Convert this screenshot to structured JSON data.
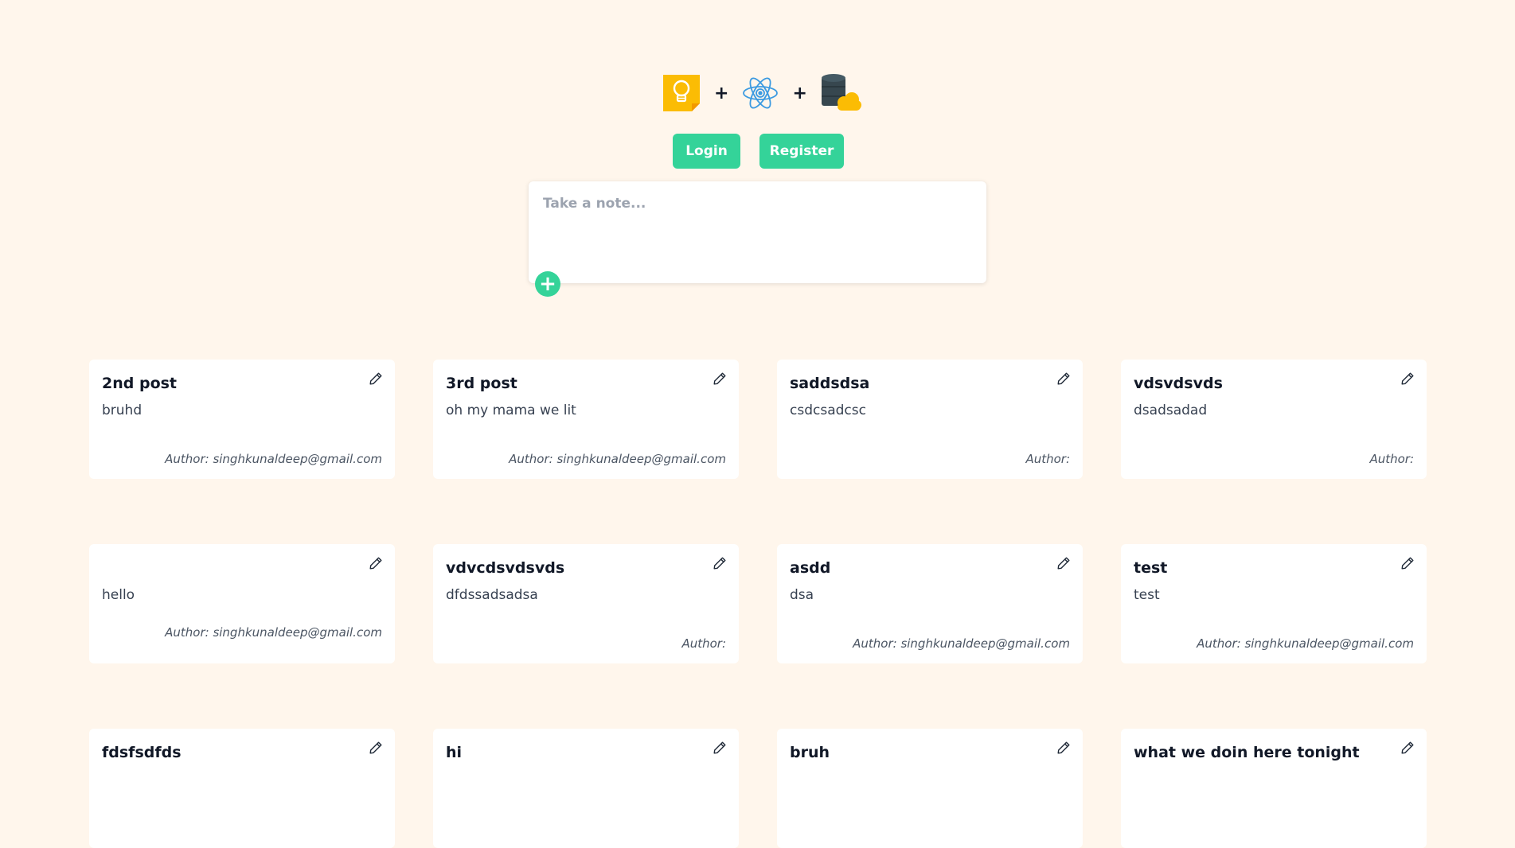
{
  "header": {
    "logos": [
      {
        "icon": "lightbulb-note-icon",
        "color": "#fbbc04"
      },
      {
        "icon": "react-atom-icon",
        "color": "#3b9ae1"
      },
      {
        "icon": "database-cloud-icon",
        "color": "#37474f"
      }
    ],
    "plus_1": "+",
    "plus_2": "+"
  },
  "auth": {
    "login_label": "Login",
    "register_label": "Register"
  },
  "composer": {
    "placeholder": "Take a note...",
    "add_label": "+"
  },
  "colors": {
    "background": "#fff6ec",
    "accent": "#34d399",
    "card": "#ffffff"
  },
  "notes": [
    {
      "title": "2nd post",
      "body": "bruhd",
      "author": "Author: singhkunaldeep@gmail.com"
    },
    {
      "title": "3rd post",
      "body": "oh my mama we lit",
      "author": "Author: singhkunaldeep@gmail.com"
    },
    {
      "title": "saddsdsa",
      "body": "csdcsadcsc",
      "author": "Author:"
    },
    {
      "title": "vdsvdsvds",
      "body": "dsadsadad",
      "author": "Author:"
    },
    {
      "title": "",
      "body": "hello",
      "author": "Author: singhkunaldeep@gmail.com"
    },
    {
      "title": "vdvcdsvdsvds",
      "body": "dfdssadsadsa",
      "author": "Author:"
    },
    {
      "title": "asdd",
      "body": "dsa",
      "author": "Author: singhkunaldeep@gmail.com"
    },
    {
      "title": "test",
      "body": "test",
      "author": "Author: singhkunaldeep@gmail.com"
    },
    {
      "title": "fdsfsdfds",
      "body": "",
      "author": ""
    },
    {
      "title": "hi",
      "body": "",
      "author": ""
    },
    {
      "title": "bruh",
      "body": "",
      "author": ""
    },
    {
      "title": "what we doin here tonight",
      "body": "",
      "author": ""
    }
  ]
}
